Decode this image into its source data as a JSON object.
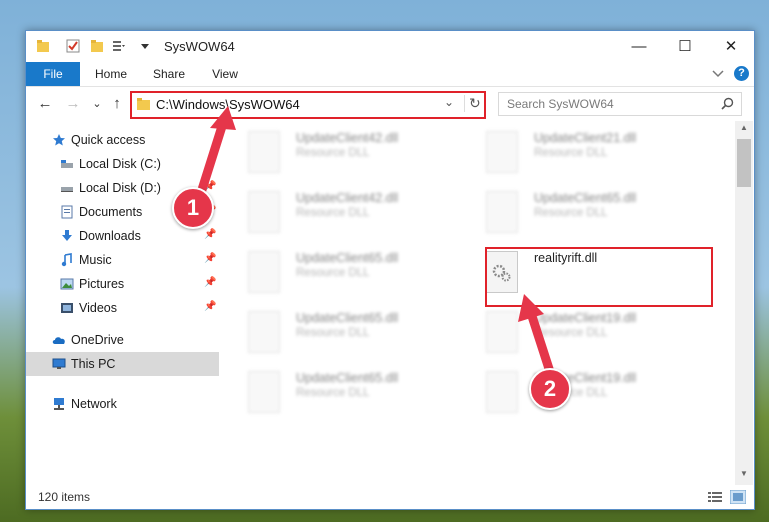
{
  "window": {
    "title": "SysWOW64",
    "minimize": "—",
    "maximize": "☐",
    "close": "✕"
  },
  "ribbon": {
    "tabs": [
      {
        "label": "File"
      },
      {
        "label": "Home"
      },
      {
        "label": "Share"
      },
      {
        "label": "View"
      }
    ],
    "help": "?"
  },
  "address_bar": {
    "path": "C:\\Windows\\SysWOW64",
    "back": "←",
    "forward": "→",
    "recent": "⌄",
    "up": "↑",
    "dropdown": "⌄",
    "refresh": "↻"
  },
  "search": {
    "placeholder": "Search SysWOW64"
  },
  "nav_pane": {
    "items": [
      {
        "label": "Quick access",
        "icon": "star-icon",
        "pinned": false
      },
      {
        "label": "Local Disk (C:)",
        "icon": "drive-icon",
        "pinned": false
      },
      {
        "label": "Local Disk (D:)",
        "icon": "drive-icon",
        "pinned": true
      },
      {
        "label": "Documents",
        "icon": "documents-icon",
        "pinned": true
      },
      {
        "label": "Downloads",
        "icon": "downloads-icon",
        "pinned": true
      },
      {
        "label": "Music",
        "icon": "music-icon",
        "pinned": true
      },
      {
        "label": "Pictures",
        "icon": "pictures-icon",
        "pinned": true
      },
      {
        "label": "Videos",
        "icon": "videos-icon",
        "pinned": true
      },
      {
        "label": "OneDrive",
        "icon": "onedrive-icon",
        "pinned": false
      },
      {
        "label": "This PC",
        "icon": "pc-icon",
        "pinned": false,
        "selected": true
      },
      {
        "label": "Network",
        "icon": "network-icon",
        "pinned": false
      }
    ]
  },
  "files": [
    {
      "name": "UpdateClient42.dll",
      "type": "Resource DLL"
    },
    {
      "name": "UpdateClient21.dll",
      "type": "Resource DLL"
    },
    {
      "name": "UpdateClient42.dll",
      "type": "Resource DLL"
    },
    {
      "name": "UpdateClient65.dll",
      "type": "Resource DLL"
    },
    {
      "name": "UpdateClient65.dll",
      "type": "Resource DLL"
    },
    {
      "name": "realityrift.dll",
      "type": ""
    },
    {
      "name": "UpdateClient65.dll",
      "type": "Resource DLL"
    },
    {
      "name": "UpdateClient19.dll",
      "type": "Resource DLL"
    },
    {
      "name": "UpdateClient65.dll",
      "type": "Resource DLL"
    },
    {
      "name": "UpdateClient19.dll",
      "type": "Resource DLL"
    }
  ],
  "callouts": {
    "one": "1",
    "two": "2"
  },
  "status": {
    "item_count": "120 items"
  },
  "colors": {
    "accent": "#1979ca",
    "highlight": "#e0222a",
    "callout": "#e5364a"
  }
}
